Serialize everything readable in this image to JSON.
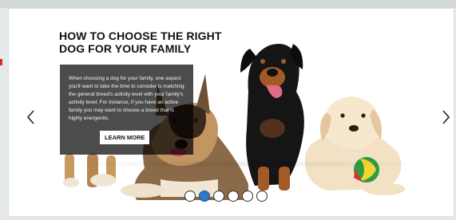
{
  "banner": {
    "headline_line1": "HOW TO CHOOSE THE RIGHT",
    "headline_line2": "DOG FOR YOUR FAMILY",
    "body": "When choosing a dog for your family, one aspect you'll want to take the time to consider is matching the general breed's activity level with your family's activity level. For instance, if you have an active family you may want to choose a breed that is highly energentic.",
    "cta_label": "LEARN MORE"
  },
  "carousel": {
    "slide_count": 6,
    "active_index": 1,
    "active_color": "#2f79c9"
  },
  "icons": {
    "prev": "chevron-left-icon",
    "next": "chevron-right-icon"
  }
}
